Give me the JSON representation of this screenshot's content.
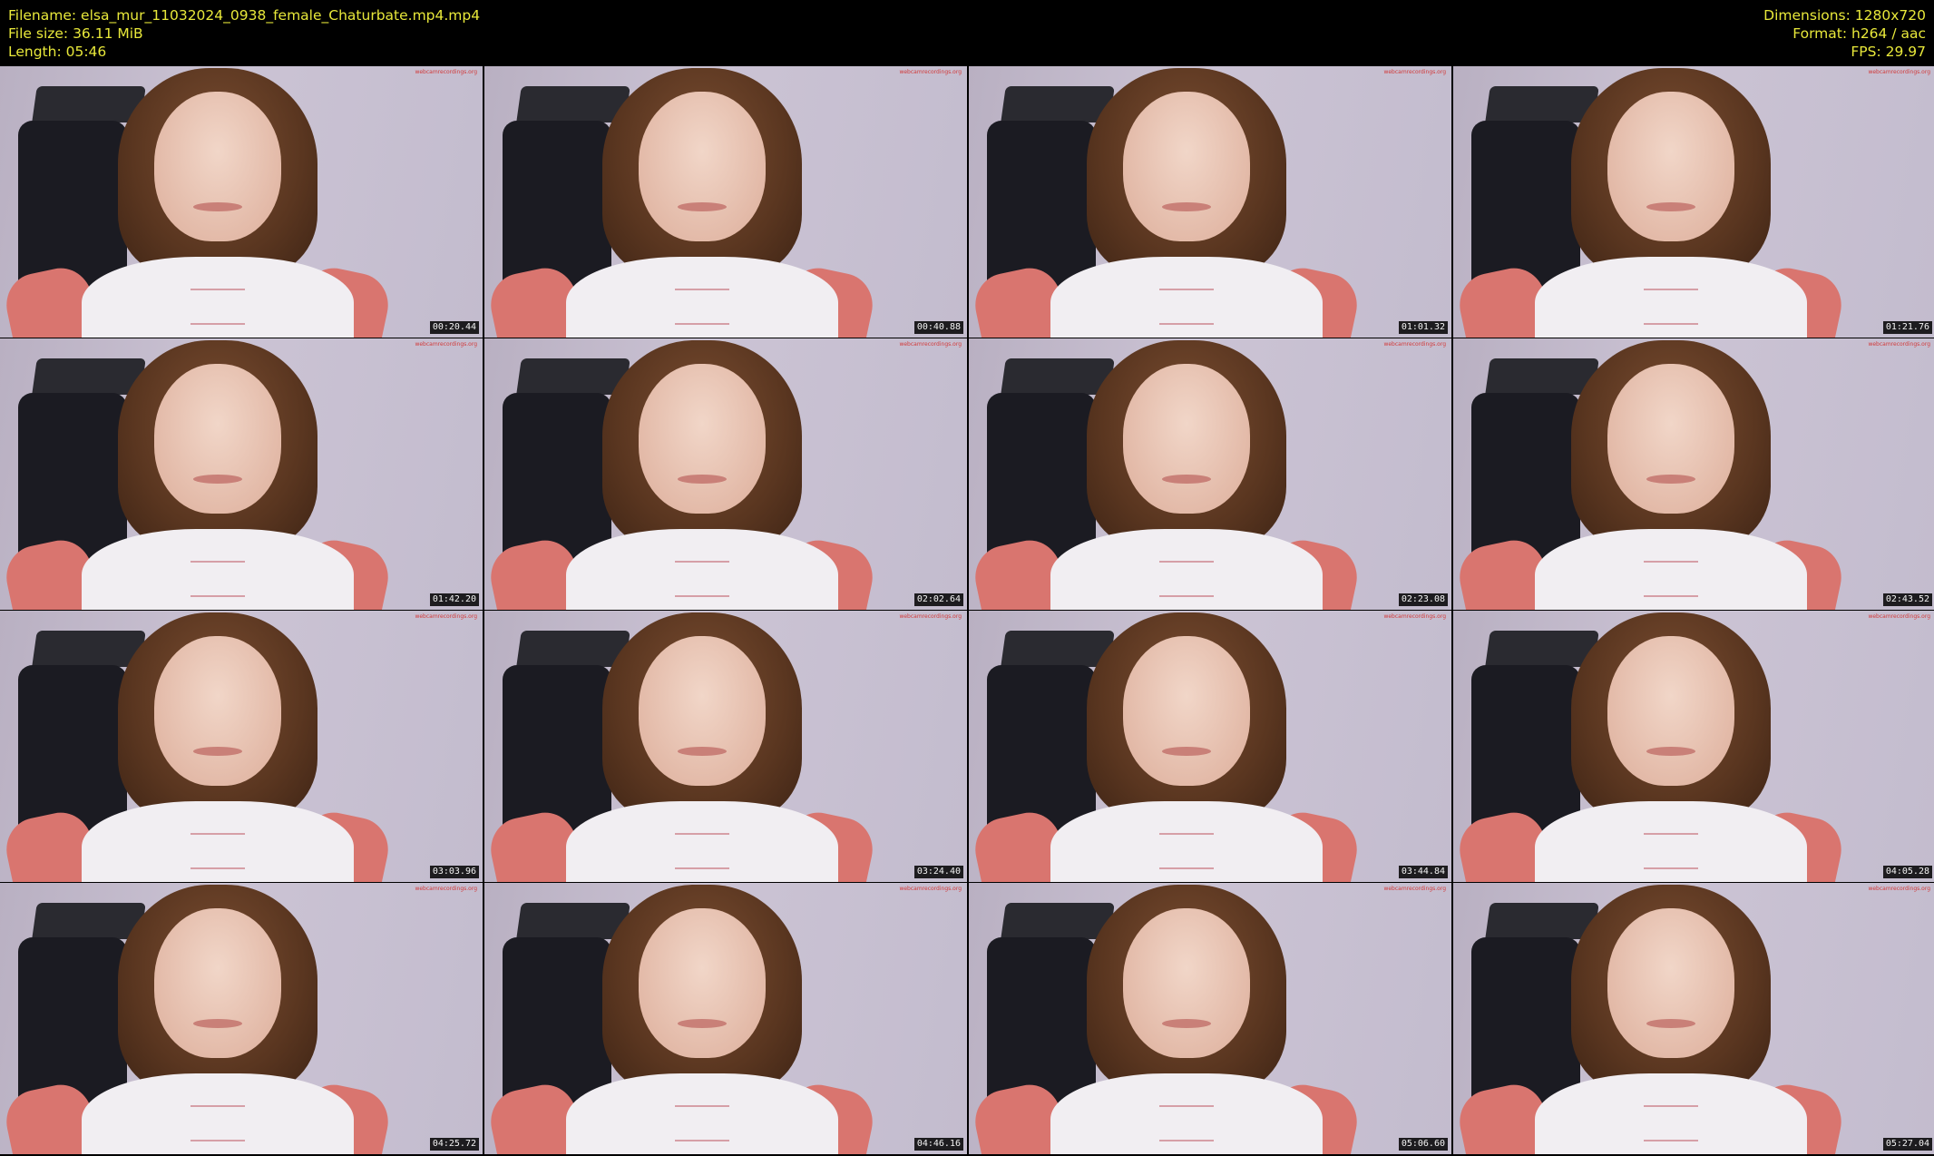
{
  "info": {
    "filename": "Filename: elsa_mur_11032024_0938_female_Chaturbate.mp4.mp4",
    "filesize": "File size: 36.11 MiB",
    "length": "Length: 05:46",
    "dimensions": "Dimensions: 1280x720",
    "format": "Format: h264 / aac",
    "fps": "FPS: 29.97"
  },
  "colors": {
    "header_text": "#e8e83a",
    "background": "#000000"
  },
  "watermark": "webcamrecordings.org",
  "thumbnails": [
    {
      "timestamp": "00:20.44"
    },
    {
      "timestamp": "00:40.88"
    },
    {
      "timestamp": "01:01.32"
    },
    {
      "timestamp": "01:21.76"
    },
    {
      "timestamp": "01:42.20"
    },
    {
      "timestamp": "02:02.64"
    },
    {
      "timestamp": "02:23.08"
    },
    {
      "timestamp": "02:43.52"
    },
    {
      "timestamp": "03:03.96"
    },
    {
      "timestamp": "03:24.40"
    },
    {
      "timestamp": "03:44.84"
    },
    {
      "timestamp": "04:05.28"
    },
    {
      "timestamp": "04:25.72"
    },
    {
      "timestamp": "04:46.16"
    },
    {
      "timestamp": "05:06.60"
    },
    {
      "timestamp": "05:27.04"
    }
  ]
}
